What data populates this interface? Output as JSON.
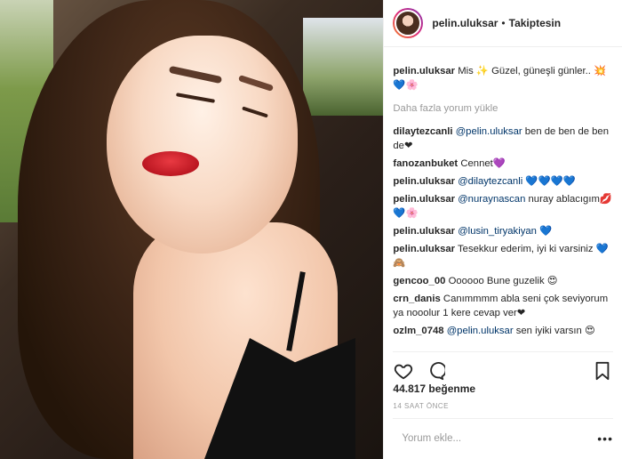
{
  "header": {
    "username": "pelin.uluksar",
    "separator": "•",
    "follow_status": "Takiptesin"
  },
  "caption": {
    "username": "pelin.uluksar",
    "text": "Mis ✨ Güzel, güneşli günler.. 💥💙🌸"
  },
  "load_more": "Daha fazla yorum yükle",
  "comments": [
    {
      "user": "dilaytezcanli",
      "mention": "@pelin.uluksar",
      "text": " ben de ben de ben de❤"
    },
    {
      "user": "fanozanbuket",
      "mention": "",
      "text": "Cennet💜"
    },
    {
      "user": "pelin.uluksar",
      "mention": "@dilaytezcanli",
      "text": " 💙💙💙💙"
    },
    {
      "user": "pelin.uluksar",
      "mention": "@nuraynascan",
      "text": " nuray ablacıgım💋💙🌸"
    },
    {
      "user": "pelin.uluksar",
      "mention": "@lusin_tiryakiyan",
      "text": " 💙"
    },
    {
      "user": "pelin.uluksar",
      "mention": "",
      "text": "Tesekkur ederim, iyi ki varsiniz 💙🙈"
    },
    {
      "user": "gencoo_00",
      "mention": "",
      "text": "Oooooo Bune guzelik 😍"
    },
    {
      "user": "crn_danis",
      "mention": "",
      "text": "Canımmmm abla seni çok seviyorum ya nooolur 1 kere cevap ver❤"
    },
    {
      "user": "ozlm_0748",
      "mention": "@pelin.uluksar",
      "text": " sen iyiki varsın 😍"
    }
  ],
  "likes": "44.817 beğenme",
  "timestamp": "14 SAAT ÖNCE",
  "comment_input": {
    "placeholder": "Yorum ekle..."
  },
  "more_options": "•••",
  "icons": [
    "heart-icon",
    "comment-icon",
    "bookmark-icon",
    "more-options-icon"
  ]
}
